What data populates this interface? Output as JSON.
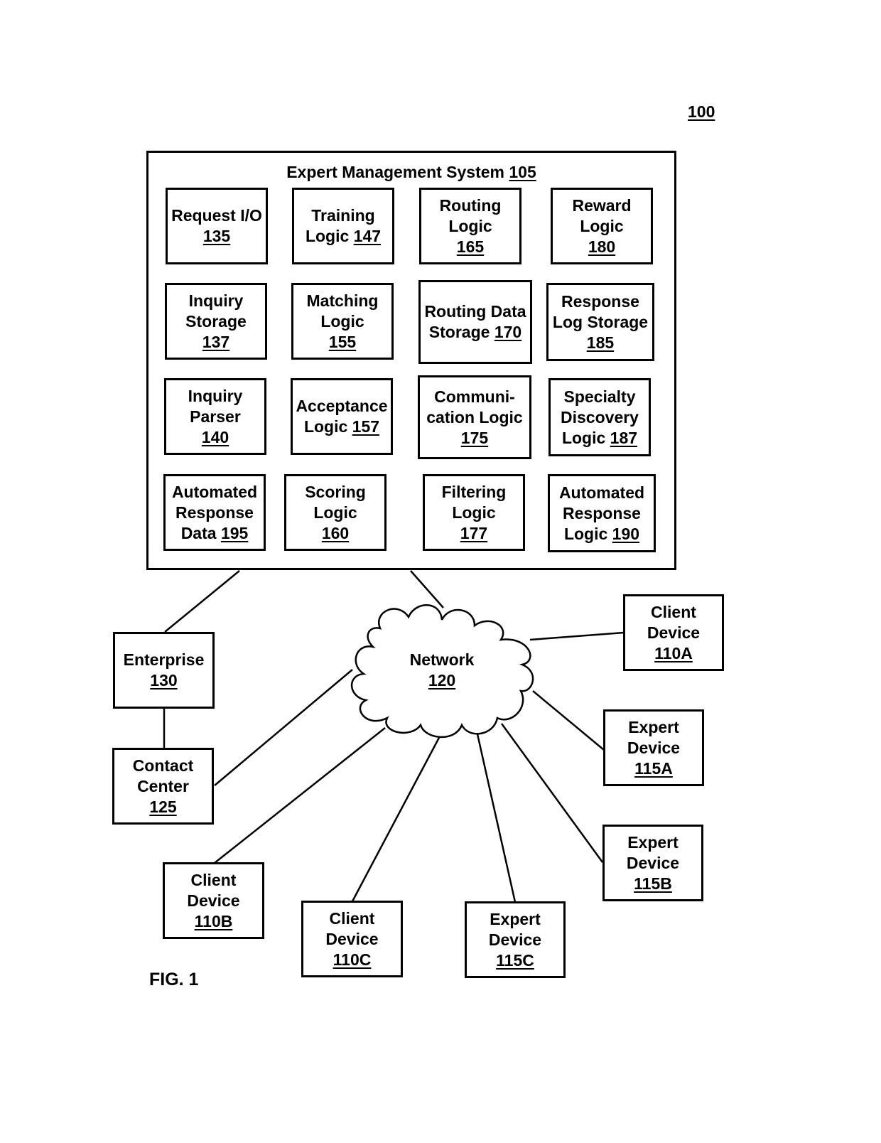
{
  "figure": {
    "number_ref": "100",
    "caption": "FIG. 1"
  },
  "system": {
    "title": "Expert Management System",
    "ref": "105",
    "components": [
      {
        "id": "request-io",
        "lines": [
          "Request I/O"
        ],
        "ref": "135"
      },
      {
        "id": "training-logic",
        "lines": [
          "Training",
          "Logic"
        ],
        "ref": "147",
        "ref_inline": true
      },
      {
        "id": "routing-logic",
        "lines": [
          "Routing",
          "Logic"
        ],
        "ref": "165"
      },
      {
        "id": "reward-logic",
        "lines": [
          "Reward",
          "Logic"
        ],
        "ref": "180"
      },
      {
        "id": "inquiry-storage",
        "lines": [
          "Inquiry",
          "Storage"
        ],
        "ref": "137"
      },
      {
        "id": "matching-logic",
        "lines": [
          "Matching",
          "Logic"
        ],
        "ref": "155"
      },
      {
        "id": "routing-data-storage",
        "lines": [
          "Routing Data",
          "Storage"
        ],
        "ref": "170",
        "ref_inline": true
      },
      {
        "id": "response-log-storage",
        "lines": [
          "Response",
          "Log Storage"
        ],
        "ref": "185"
      },
      {
        "id": "inquiry-parser",
        "lines": [
          "Inquiry",
          "Parser"
        ],
        "ref": "140"
      },
      {
        "id": "acceptance-logic",
        "lines": [
          "Acceptance",
          "Logic"
        ],
        "ref": "157",
        "ref_inline": true
      },
      {
        "id": "communication-logic",
        "lines": [
          "Communi-",
          "cation Logic"
        ],
        "ref": "175"
      },
      {
        "id": "specialty-discovery-logic",
        "lines": [
          "Specialty",
          "Discovery",
          "Logic"
        ],
        "ref": "187",
        "ref_inline": true
      },
      {
        "id": "automated-response-data",
        "lines": [
          "Automated",
          "Response",
          "Data"
        ],
        "ref": "195",
        "ref_inline": true
      },
      {
        "id": "scoring-logic",
        "lines": [
          "Scoring",
          "Logic"
        ],
        "ref": "160"
      },
      {
        "id": "filtering-logic",
        "lines": [
          "Filtering",
          "Logic"
        ],
        "ref": "177"
      },
      {
        "id": "automated-response-logic",
        "lines": [
          "Automated",
          "Response",
          "Logic"
        ],
        "ref": "190",
        "ref_inline": true
      }
    ]
  },
  "network": {
    "label": "Network",
    "ref": "120"
  },
  "external": [
    {
      "id": "enterprise",
      "lines": [
        "Enterprise"
      ],
      "ref": "130"
    },
    {
      "id": "contact-center",
      "lines": [
        "Contact",
        "Center"
      ],
      "ref": "125"
    },
    {
      "id": "client-device-110a",
      "lines": [
        "Client",
        "Device"
      ],
      "ref": "110A"
    },
    {
      "id": "expert-device-115a",
      "lines": [
        "Expert",
        "Device"
      ],
      "ref": "115A"
    },
    {
      "id": "expert-device-115b",
      "lines": [
        "Expert",
        "Device"
      ],
      "ref": "115B"
    },
    {
      "id": "client-device-110b",
      "lines": [
        "Client",
        "Device"
      ],
      "ref": "110B"
    },
    {
      "id": "client-device-110c",
      "lines": [
        "Client",
        "Device"
      ],
      "ref": "110C"
    },
    {
      "id": "expert-device-115c",
      "lines": [
        "Expert",
        "Device"
      ],
      "ref": "115C"
    }
  ]
}
